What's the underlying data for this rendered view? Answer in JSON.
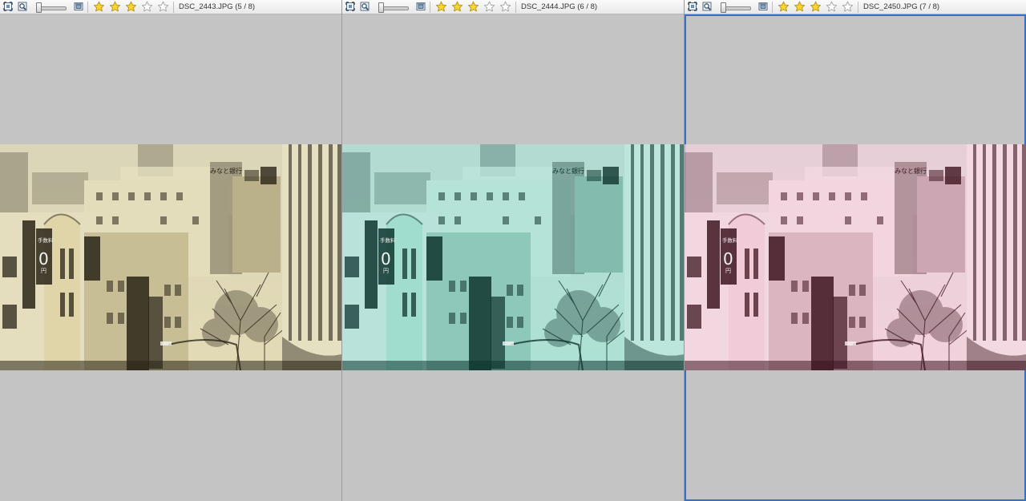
{
  "panels": [
    {
      "filename": "DSC_2443.JPG (5 / 8)",
      "rating": 3,
      "max_rating": 5,
      "tint": "#e9dfb0",
      "shadow": "#2a2418",
      "selected": false
    },
    {
      "filename": "DSC_2444.JPG (6 / 8)",
      "rating": 3,
      "max_rating": 5,
      "tint": "#a8e6d8",
      "shadow": "#0f3530",
      "selected": false
    },
    {
      "filename": "DSC_2450.JPG (7 / 8)",
      "rating": 3,
      "max_rating": 5,
      "tint": "#fbd6e2",
      "shadow": "#3e1622",
      "selected": true
    }
  ],
  "photo_signs": {
    "bank": "みなと銀行",
    "fee_label": "手数料",
    "fee_value": "0",
    "fee_unit": "円"
  },
  "icons": [
    "fit-to-window-icon",
    "zoom-icon",
    "zoom-slider",
    "actual-size-icon",
    "star-icon"
  ],
  "colors": {
    "panel_bg": "#c4c4c4",
    "toolbar_bg": "#f2f2f2",
    "selected_border": "#3a6fc8",
    "star_fill": "#f7d62e"
  }
}
